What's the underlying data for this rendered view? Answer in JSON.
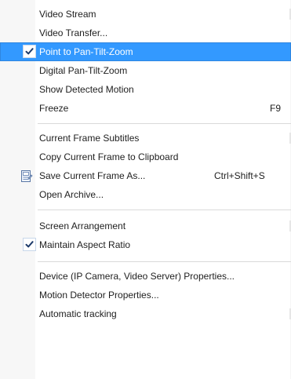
{
  "menu": {
    "items": [
      {
        "label": "Video Stream"
      },
      {
        "label": "Video Transfer..."
      },
      {
        "label": "Point to Pan-Tilt-Zoom"
      },
      {
        "label": "Digital Pan-Tilt-Zoom"
      },
      {
        "label": "Show Detected Motion"
      },
      {
        "label": "Freeze",
        "shortcut": "F9"
      },
      {
        "label": "Current Frame Subtitles"
      },
      {
        "label": "Copy Current Frame to Clipboard"
      },
      {
        "label": "Save Current Frame As...",
        "shortcut": "Ctrl+Shift+S"
      },
      {
        "label": "Open Archive..."
      },
      {
        "label": "Screen Arrangement"
      },
      {
        "label": "Maintain Aspect Ratio"
      },
      {
        "label": "Device (IP Camera, Video Server) Properties..."
      },
      {
        "label": "Motion Detector Properties..."
      },
      {
        "label": "Automatic tracking"
      }
    ],
    "checked_items": [
      "Point to Pan-Tilt-Zoom",
      "Maintain Aspect Ratio"
    ],
    "highlighted_item": "Point to Pan-Tilt-Zoom",
    "icons": {
      "check": "checkmark-icon",
      "save": "save-frame-icon"
    },
    "colors": {
      "highlight": "#3399ff",
      "text": "#1e1e1e",
      "separator": "#dadada",
      "gutter": "#f7f7f7"
    }
  }
}
